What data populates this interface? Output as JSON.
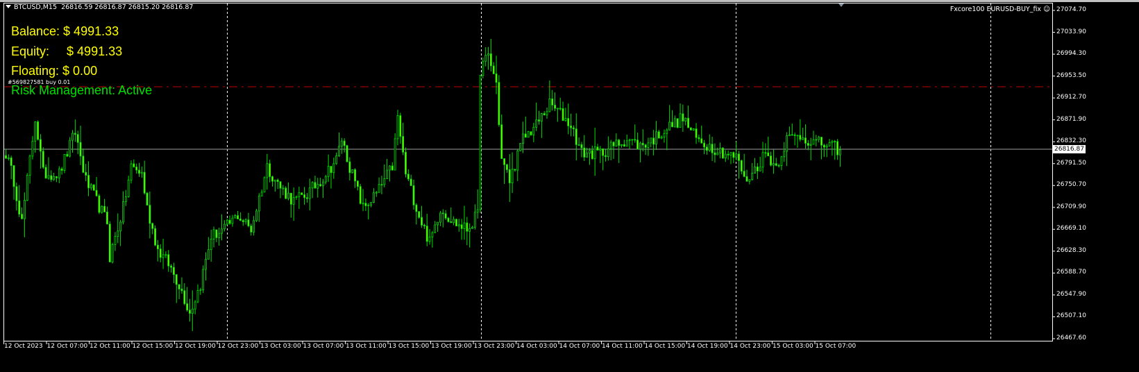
{
  "header": {
    "symbol": "BTCUSD,M15",
    "ohlc": "26816.59 26816.87 26815.20 26816.87"
  },
  "indicator": {
    "label": "Fxcore100 EURUSD-BUY_fix",
    "icon": "smiley-icon"
  },
  "account": {
    "balance": "Balance: $ 4991.33",
    "equity": "Equity:     $ 4991.33",
    "floating": "Floating: $ 0.00",
    "risk": "Risk Management: Active"
  },
  "order_label": "#569827581 buy 0.01",
  "current_price": "26816.87",
  "colors": {
    "background": "#000000",
    "candle": "#00e000",
    "bear_fill": "#7cfc00",
    "order_line": "#c00000",
    "grid": "#ffffff",
    "text": "#ffffff",
    "info": "#ffff00"
  },
  "chart_data": {
    "type": "candlestick",
    "symbol": "BTCUSD",
    "timeframe": "M15",
    "ylim": [
      26467.6,
      27074.7
    ],
    "price_ticks": [
      "27074.70",
      "27033.90",
      "26994.30",
      "26953.50",
      "26912.70",
      "26871.90",
      "26832.30",
      "26791.50",
      "26750.70",
      "26709.90",
      "26669.10",
      "26628.30",
      "26588.70",
      "26547.90",
      "26507.10",
      "26467.60"
    ],
    "time_ticks": [
      "12 Oct 2023",
      "12 Oct 07:00",
      "12 Oct 11:00",
      "12 Oct 15:00",
      "12 Oct 19:00",
      "12 Oct 23:00",
      "13 Oct 03:00",
      "13 Oct 07:00",
      "13 Oct 11:00",
      "13 Oct 15:00",
      "13 Oct 19:00",
      "13 Oct 23:00",
      "14 Oct 03:00",
      "14 Oct 07:00",
      "14 Oct 11:00",
      "14 Oct 15:00",
      "14 Oct 19:00",
      "14 Oct 23:00",
      "15 Oct 03:00",
      "15 Oct 07:00"
    ],
    "order_line_price": 26933,
    "bar_count": 314,
    "close_waypoints": [
      [
        0,
        26811
      ],
      [
        3,
        26760
      ],
      [
        6,
        26683
      ],
      [
        10,
        26837
      ],
      [
        11,
        26876
      ],
      [
        14,
        26773
      ],
      [
        20,
        26773
      ],
      [
        25,
        26837
      ],
      [
        26,
        26850
      ],
      [
        30,
        26760
      ],
      [
        38,
        26683
      ],
      [
        39,
        26619
      ],
      [
        44,
        26709
      ],
      [
        47,
        26786
      ],
      [
        51,
        26773
      ],
      [
        53,
        26709
      ],
      [
        57,
        26632
      ],
      [
        61,
        26606
      ],
      [
        65,
        26568
      ],
      [
        69,
        26516
      ],
      [
        73,
        26568
      ],
      [
        77,
        26657
      ],
      [
        82,
        26670
      ],
      [
        87,
        26696
      ],
      [
        92,
        26670
      ],
      [
        98,
        26786
      ],
      [
        103,
        26747
      ],
      [
        108,
        26722
      ],
      [
        113,
        26735
      ],
      [
        118,
        26760
      ],
      [
        124,
        26799
      ],
      [
        126,
        26837
      ],
      [
        129,
        26786
      ],
      [
        134,
        26709
      ],
      [
        139,
        26735
      ],
      [
        145,
        26786
      ],
      [
        147,
        26876
      ],
      [
        150,
        26773
      ],
      [
        155,
        26696
      ],
      [
        159,
        26645
      ],
      [
        163,
        26709
      ],
      [
        168,
        26683
      ],
      [
        173,
        26670
      ],
      [
        177,
        26696
      ],
      [
        178,
        26966
      ],
      [
        181,
        26991
      ],
      [
        184,
        26940
      ],
      [
        186,
        26799
      ],
      [
        189,
        26760
      ],
      [
        194,
        26837
      ],
      [
        199,
        26863
      ],
      [
        204,
        26901
      ],
      [
        207,
        26889
      ],
      [
        212,
        26863
      ],
      [
        216,
        26811
      ],
      [
        223,
        26811
      ],
      [
        228,
        26824
      ],
      [
        233,
        26837
      ],
      [
        238,
        26824
      ],
      [
        243,
        26837
      ],
      [
        246,
        26850
      ],
      [
        254,
        26876
      ],
      [
        259,
        26837
      ],
      [
        264,
        26824
      ],
      [
        270,
        26811
      ],
      [
        275,
        26799
      ],
      [
        277,
        26760
      ],
      [
        280,
        26773
      ],
      [
        285,
        26811
      ],
      [
        289,
        26786
      ],
      [
        293,
        26837
      ],
      [
        298,
        26843
      ],
      [
        303,
        26831
      ],
      [
        309,
        26824
      ],
      [
        313,
        26817
      ]
    ]
  }
}
